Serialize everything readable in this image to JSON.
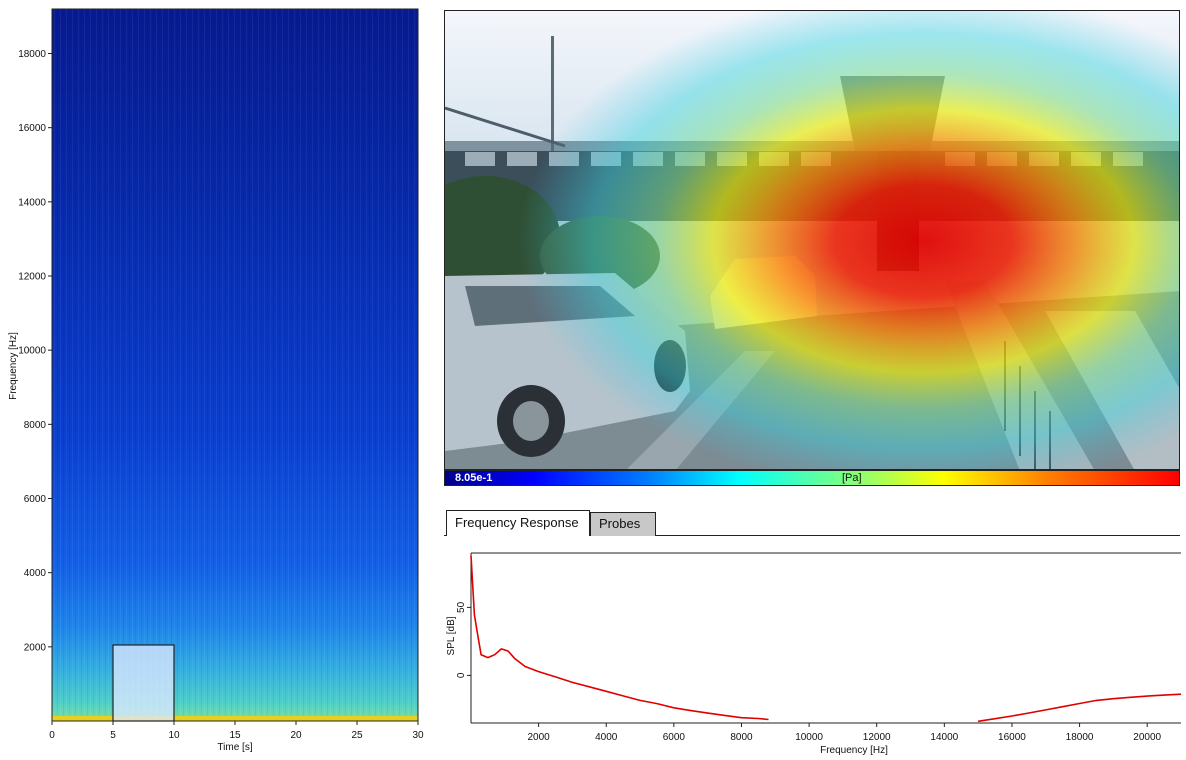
{
  "spectrogram": {
    "ylabel": "Frequency [Hz]",
    "xlabel": "Time [s]",
    "y_ticks": [
      "2000",
      "4000",
      "6000",
      "8000",
      "10000",
      "12000",
      "14000",
      "16000",
      "18000"
    ],
    "x_ticks": [
      "0",
      "5",
      "10",
      "15",
      "20",
      "25",
      "30"
    ],
    "selection": {
      "t_start": 5,
      "t_end": 10,
      "f_start": 0,
      "f_end": 2050
    }
  },
  "camera": {
    "colorbar_min": "8.05e-1",
    "colorbar_unit": "[Pa]"
  },
  "tabs": [
    {
      "label": "Frequency Response",
      "active": true
    },
    {
      "label": "Probes",
      "active": false
    }
  ],
  "frequency_response": {
    "ylabel": "SPL [dB]",
    "xlabel": "Frequency [Hz]",
    "y_ticks": [
      "0",
      "50"
    ],
    "x_ticks": [
      "2000",
      "4000",
      "6000",
      "8000",
      "10000",
      "12000",
      "14000",
      "16000",
      "18000",
      "20000"
    ]
  },
  "chart_data": [
    {
      "type": "heatmap",
      "title": "",
      "xlabel": "Time [s]",
      "ylabel": "Frequency [Hz]",
      "xlim": [
        0,
        30
      ],
      "ylim": [
        0,
        19200
      ],
      "x_ticks": [
        0,
        5,
        10,
        15,
        20,
        25,
        30
      ],
      "y_ticks": [
        2000,
        4000,
        6000,
        8000,
        10000,
        12000,
        14000,
        16000,
        18000
      ],
      "selection_box": {
        "x": [
          5,
          10
        ],
        "y": [
          0,
          2050
        ]
      }
    },
    {
      "type": "line",
      "title": "",
      "xlabel": "Frequency [Hz]",
      "ylabel": "SPL [dB]",
      "xlim": [
        0,
        21000
      ],
      "ylim": [
        -35,
        90
      ],
      "x_ticks": [
        2000,
        4000,
        6000,
        8000,
        10000,
        12000,
        14000,
        16000,
        18000,
        20000
      ],
      "y_ticks": [
        0,
        50
      ],
      "series": [
        {
          "color": "#e00000",
          "x": [
            0,
            100,
            200,
            300,
            500,
            700,
            900,
            1100,
            1300,
            1600,
            2000,
            2500,
            3000,
            3500,
            4000,
            4500,
            5000,
            5500,
            6000,
            6500,
            7000,
            7500,
            8000,
            8500,
            8800,
            15000,
            15500,
            16000,
            16500,
            17000,
            17500,
            18000,
            18500,
            19000,
            19500,
            20000,
            20500,
            21000
          ],
          "y": [
            88,
            45,
            30,
            16,
            14,
            16,
            20,
            18,
            12,
            6,
            2,
            -2,
            -6,
            -9,
            -12,
            -15,
            -18,
            -20,
            -23,
            -25,
            -27,
            -29,
            -31,
            -32,
            -33,
            -33,
            -31,
            -29,
            -27,
            -25,
            -23,
            -21,
            -19,
            -18,
            -17,
            -16,
            -15,
            -14
          ]
        }
      ]
    }
  ]
}
